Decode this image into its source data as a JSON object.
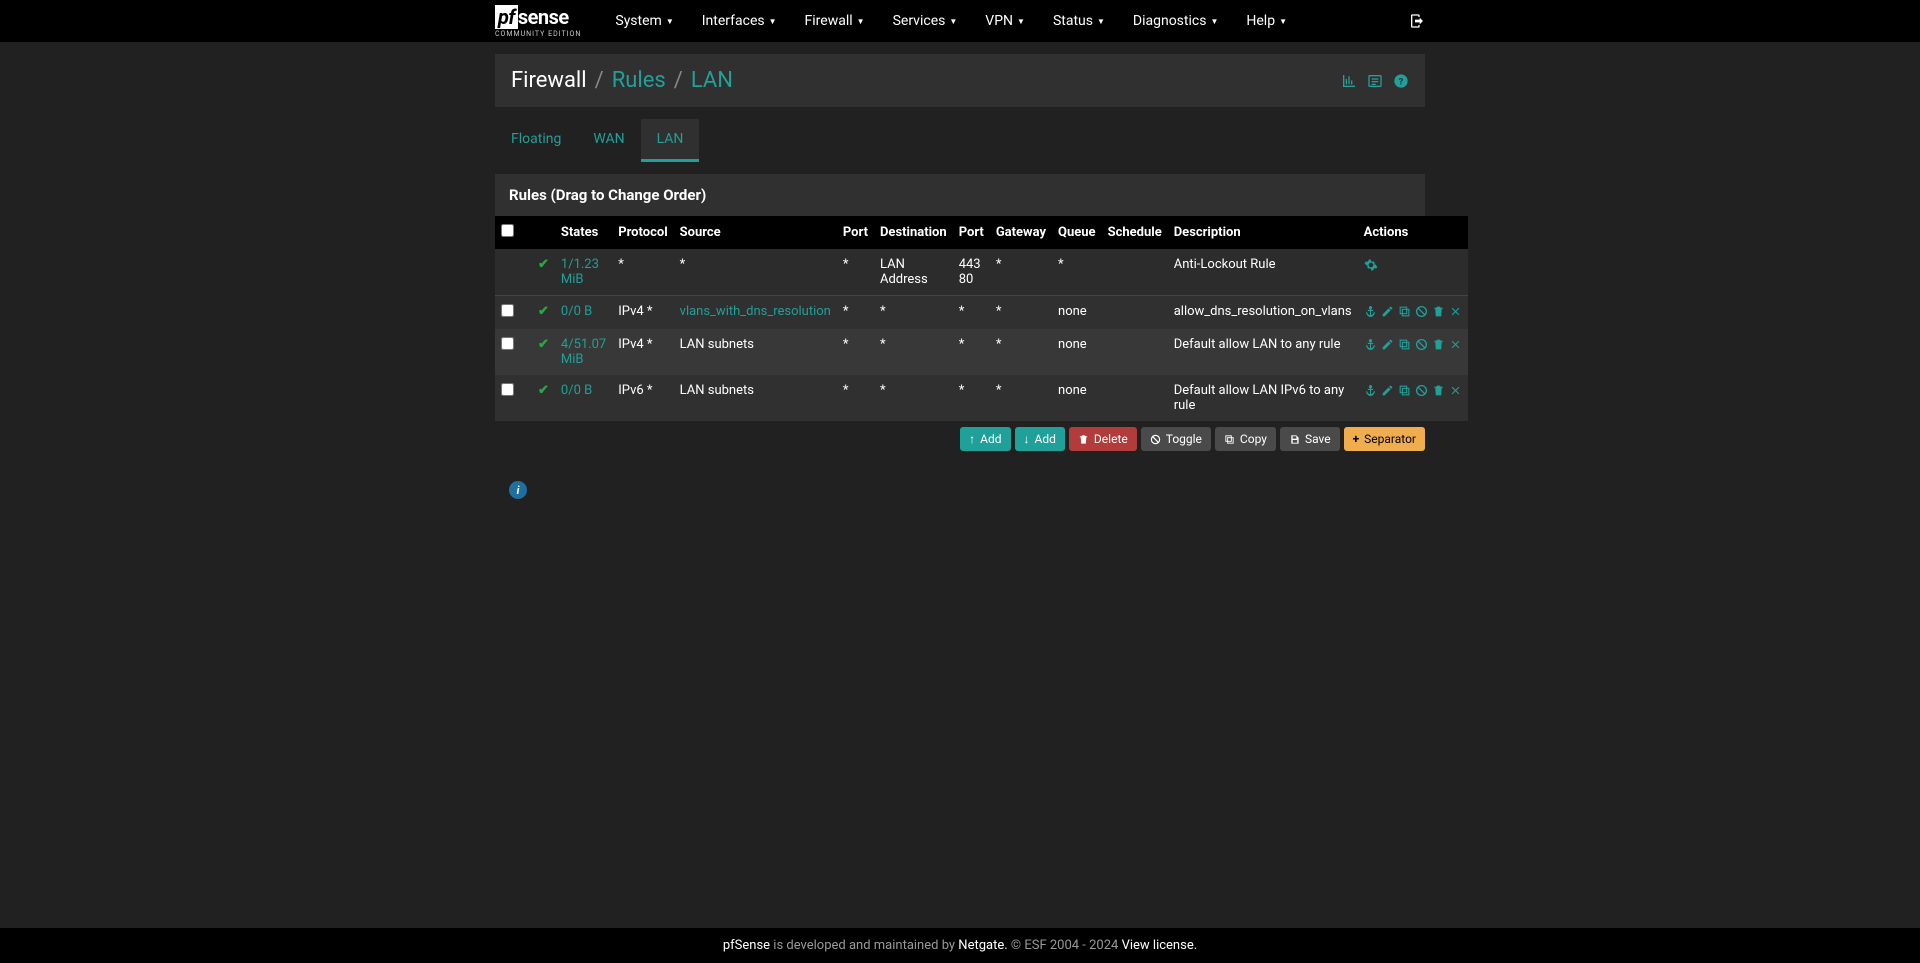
{
  "logo": {
    "main_pf": "pf",
    "main_sense": "sense",
    "sub": "COMMUNITY EDITION"
  },
  "nav": {
    "items": [
      "System",
      "Interfaces",
      "Firewall",
      "Services",
      "VPN",
      "Status",
      "Diagnostics",
      "Help"
    ]
  },
  "breadcrumb": {
    "root": "Firewall",
    "mid": "Rules",
    "leaf": "LAN"
  },
  "tabs": {
    "items": [
      "Floating",
      "WAN",
      "LAN"
    ],
    "active": "LAN"
  },
  "panel": {
    "heading": "Rules (Drag to Change Order)"
  },
  "columns": [
    "",
    "",
    "",
    "States",
    "Protocol",
    "Source",
    "Port",
    "Destination",
    "Port",
    "Gateway",
    "Queue",
    "Schedule",
    "Description",
    "Actions"
  ],
  "rows": [
    {
      "checkbox": false,
      "states": "1/1.23 MiB",
      "protocol": "*",
      "source": "*",
      "source_link": false,
      "sport": "*",
      "dest": "LAN Address",
      "dport": "443\n80",
      "gateway": "*",
      "queue": "*",
      "schedule": "",
      "desc": "Anti-Lockout Rule",
      "system": true
    },
    {
      "checkbox": true,
      "states": "0/0 B",
      "protocol": "IPv4 *",
      "source": "vlans_with_dns_resolution",
      "source_link": true,
      "sport": "*",
      "dest": "*",
      "dport": "*",
      "gateway": "*",
      "queue": "none",
      "schedule": "",
      "desc": "allow_dns_resolution_on_vlans",
      "system": false
    },
    {
      "checkbox": true,
      "states": "4/51.07 MiB",
      "protocol": "IPv4 *",
      "source": "LAN subnets",
      "source_link": false,
      "sport": "*",
      "dest": "*",
      "dport": "*",
      "gateway": "*",
      "queue": "none",
      "schedule": "",
      "desc": "Default allow LAN to any rule",
      "system": false
    },
    {
      "checkbox": true,
      "states": "0/0 B",
      "protocol": "IPv6 *",
      "source": "LAN subnets",
      "source_link": false,
      "sport": "*",
      "dest": "*",
      "dport": "*",
      "gateway": "*",
      "queue": "none",
      "schedule": "",
      "desc": "Default allow LAN IPv6 to any rule",
      "system": false
    }
  ],
  "buttons": {
    "add_top": "Add",
    "add_bottom": "Add",
    "delete": "Delete",
    "toggle": "Toggle",
    "copy": "Copy",
    "save": "Save",
    "separator": "Separator"
  },
  "footer": {
    "p1": "pfSense",
    "p2": " is developed and maintained by ",
    "p3": "Netgate.",
    "p4": " © ESF 2004 - 2024 ",
    "p5": "View license."
  }
}
